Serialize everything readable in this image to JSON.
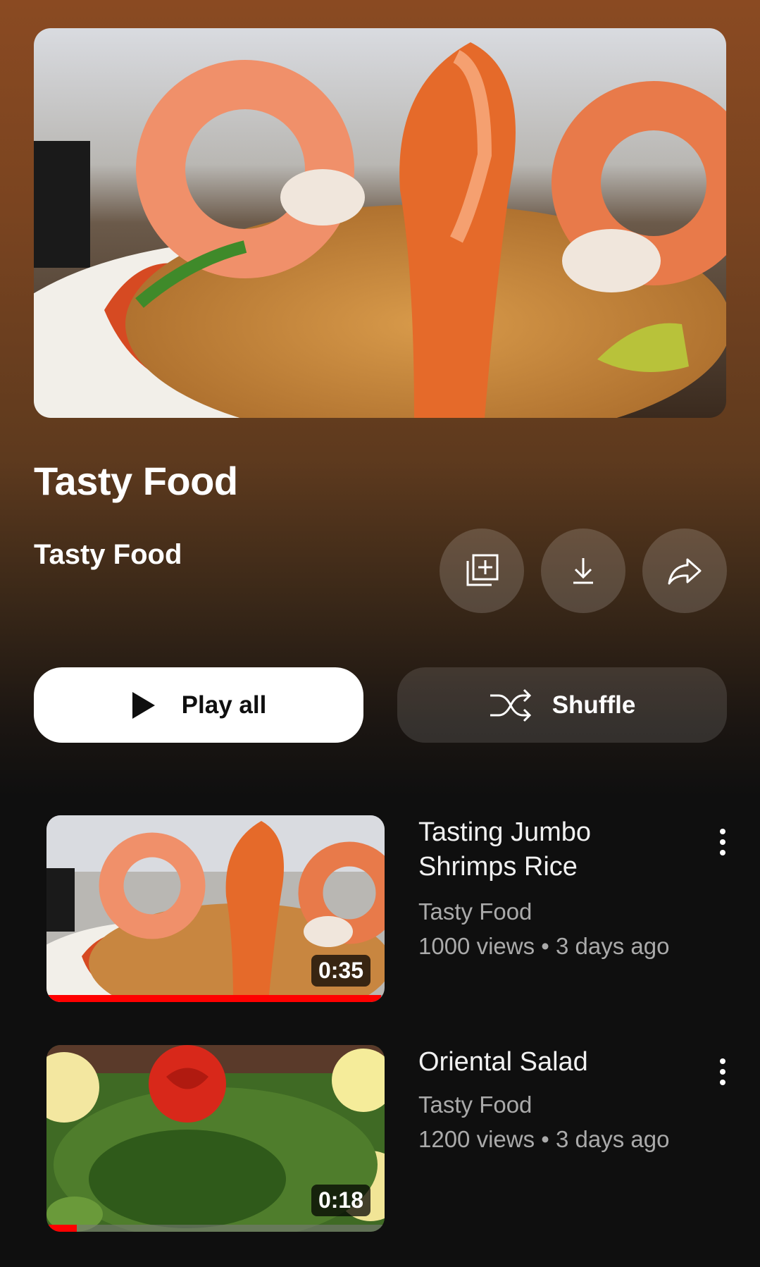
{
  "playlist": {
    "title": "Tasty Food",
    "owner": "Tasty Food",
    "actions": {
      "save_icon": "add-to-library-icon",
      "download_icon": "download-icon",
      "share_icon": "share-icon"
    },
    "play_all_label": "Play all",
    "shuffle_label": "Shuffle"
  },
  "videos": [
    {
      "title": "Tasting Jumbo Shrimps Rice",
      "channel": "Tasty Food",
      "stats": "1000 views • 3 days ago",
      "duration": "0:35",
      "watched_fraction": 0.99
    },
    {
      "title": "Oriental Salad",
      "channel": "Tasty Food",
      "stats": "1200 views • 3 days ago",
      "duration": "0:18",
      "watched_fraction": 0.09
    }
  ],
  "colors": {
    "accent": "#ff0000",
    "header_gradient_top": "#8a4a22",
    "background": "#0f0f0f"
  }
}
